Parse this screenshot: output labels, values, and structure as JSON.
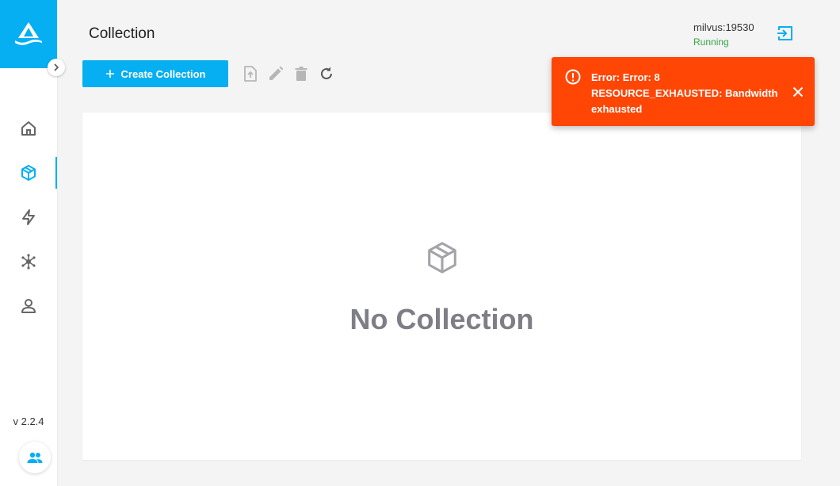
{
  "sidebar": {
    "logo": "milvus-logo",
    "collapse_icon": "chevron-right-icon",
    "items": [
      {
        "icon": "home-icon",
        "active": false
      },
      {
        "icon": "collection-cube-icon",
        "active": true
      },
      {
        "icon": "lightning-icon",
        "active": false
      },
      {
        "icon": "system-network-icon",
        "active": false
      },
      {
        "icon": "user-icon",
        "active": false
      }
    ],
    "version": "v 2.2.4",
    "team_icon": "people-icon"
  },
  "header": {
    "title": "Collection",
    "server_address": "milvus:19530",
    "server_status": "Running",
    "logout_icon": "logout-icon"
  },
  "toolbar": {
    "create_label": "Create Collection",
    "tools": [
      "import-icon",
      "edit-icon",
      "delete-icon",
      "refresh-icon"
    ]
  },
  "main": {
    "empty_icon": "cube-icon",
    "empty_text": "No Collection"
  },
  "toast": {
    "message": "Error: Error: 8 RESOURCE_EXHAUSTED: Bandwidth exhausted",
    "icon": "error-circle-icon",
    "close_icon": "close-icon"
  },
  "colors": {
    "accent": "#06aff2",
    "error": "#ff4605",
    "status_running": "#35a546",
    "empty_text": "#7e7f86"
  }
}
